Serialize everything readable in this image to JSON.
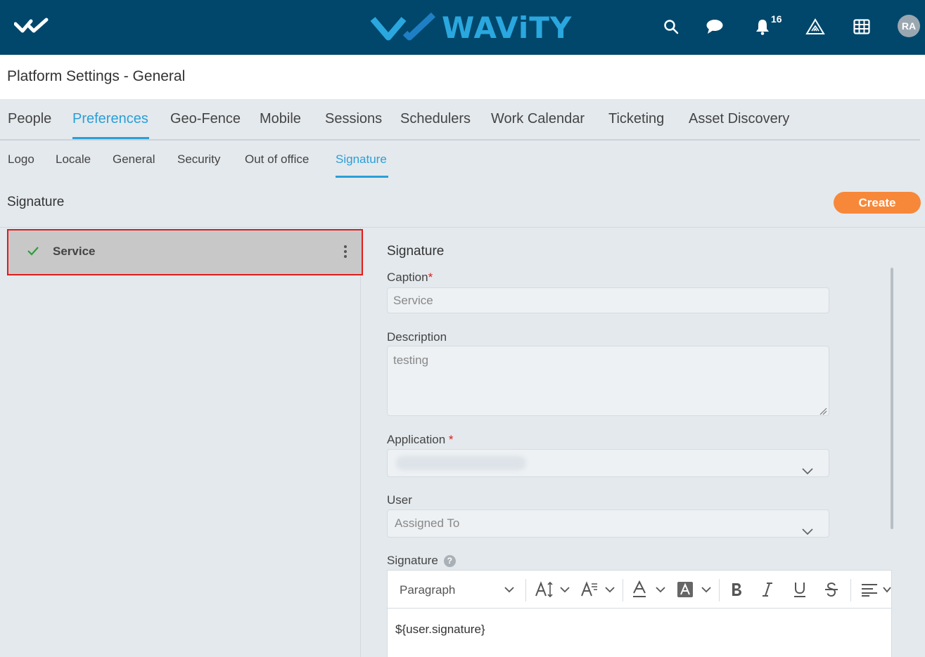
{
  "header": {
    "brand": "WAViTY",
    "notification_count": "16",
    "avatar_initials": "RA",
    "bg_color": "#00476b",
    "brand_color": "#2aa7df"
  },
  "page": {
    "title": "Platform Settings - General"
  },
  "main_tabs": [
    {
      "label": "People",
      "active": false
    },
    {
      "label": "Preferences",
      "active": true
    },
    {
      "label": "Geo-Fence",
      "active": false
    },
    {
      "label": "Mobile",
      "active": false
    },
    {
      "label": "Sessions",
      "active": false
    },
    {
      "label": "Schedulers",
      "active": false
    },
    {
      "label": "Work Calendar",
      "active": false
    },
    {
      "label": "Ticketing",
      "active": false
    },
    {
      "label": "Asset Discovery",
      "active": false
    }
  ],
  "sub_tabs": [
    {
      "label": "Logo",
      "active": false
    },
    {
      "label": "Locale",
      "active": false
    },
    {
      "label": "General",
      "active": false
    },
    {
      "label": "Security",
      "active": false
    },
    {
      "label": "Out of office",
      "active": false
    },
    {
      "label": "Signature",
      "active": true
    }
  ],
  "section": {
    "title": "Signature",
    "create_label": "Create"
  },
  "signature_list": [
    {
      "label": "Service",
      "checked": true
    }
  ],
  "form": {
    "title": "Signature",
    "caption_label": "Caption",
    "caption_value": "Service",
    "description_label": "Description",
    "description_value": "testing",
    "application_label": "Application",
    "user_label": "User",
    "user_placeholder": "Assigned To",
    "signature_label": "Signature",
    "help_glyph": "?"
  },
  "editor": {
    "paragraph_label": "Paragraph",
    "content": "${user.signature}"
  },
  "colors": {
    "accent": "#2b9fd8",
    "create_button": "#f7883a",
    "required": "#e21b1b"
  }
}
